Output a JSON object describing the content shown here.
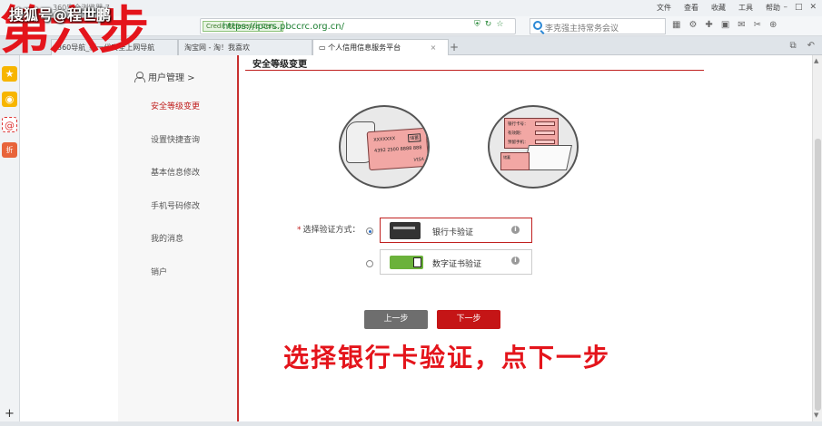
{
  "browser": {
    "title": "360安全浏览器 7",
    "menu": [
      "文件",
      "查看",
      "收藏",
      "工具",
      "帮助"
    ],
    "url_cert": "Credit Reference Cen...",
    "url": "https://ipcrs.pbccrc.org.cn/",
    "search_placeholder": "李克强主持常务会议",
    "tabs": [
      {
        "label": "360导航_新一代安全上网导航"
      },
      {
        "label": "淘宝网 - 淘！我喜欢"
      },
      {
        "label": "个人信用信息服务平台",
        "active": true
      }
    ],
    "new_tab": "+"
  },
  "sidebar": {
    "heading": "用户管理 >",
    "items": [
      {
        "label": "安全等级变更",
        "active": true
      },
      {
        "label": "设置快捷查询"
      },
      {
        "label": "基本信息修改"
      },
      {
        "label": "手机号码修改"
      },
      {
        "label": "我的消息"
      },
      {
        "label": "销户"
      }
    ]
  },
  "main": {
    "title": "安全等级变更",
    "card_illus": {
      "chip_text": "XXXXXXX",
      "tag": "储蓄",
      "number": "4392 2500 8888 888",
      "brand": "VISA"
    },
    "form_illus": {
      "rows": [
        "银行卡号：",
        "有效期：",
        "预留手机："
      ],
      "card_text": "储蓄"
    },
    "field_label": "选择验证方式：",
    "options": [
      {
        "label": "银行卡验证",
        "selected": true
      },
      {
        "label": "数字证书验证",
        "selected": false
      }
    ],
    "prev_button": "上一步",
    "next_button": "下一步"
  },
  "overlay": {
    "watermark": "搜狐号@程世鹏",
    "step_heading": "第六步",
    "caption": "选择银行卡验证，点下一步"
  },
  "colors": {
    "accent": "#c0201f",
    "button_next": "#c51516",
    "button_prev": "#6e6e6e",
    "caption": "#e4141b"
  }
}
